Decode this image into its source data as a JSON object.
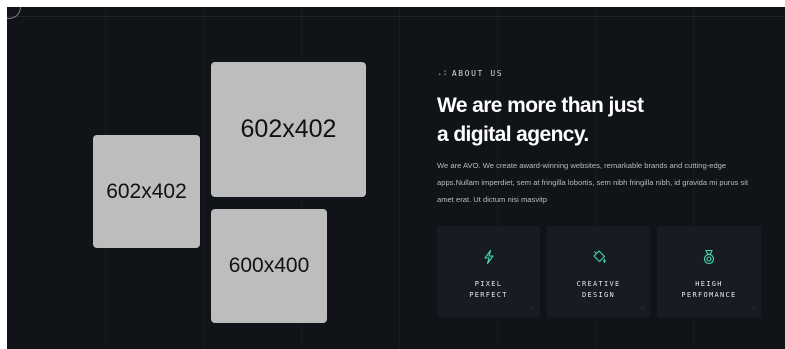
{
  "placeholders": {
    "small_left": "602x402",
    "large_top": "602x402",
    "bottom": "600x400"
  },
  "about": {
    "eyebrow_dots": ".:",
    "eyebrow": "ABOUT US",
    "headline_line1": "We are more than just",
    "headline_line2": "a digital agency.",
    "description": "We are AVO. We create award-winning websites, remarkable brands and cutting-edge apps.Nullam imperdiet, sem at fringilla lobortis, sem nibh fringilla nibh, id gravida mi purus sit amet erat. Ut dictum nisi masvitp"
  },
  "features": [
    {
      "label": "PIXEL\nPERFECT",
      "icon": "lightning-icon"
    },
    {
      "label": "CREATIVE\nDESIGN",
      "icon": "paint-bucket-icon"
    },
    {
      "label": "HEIGH\nPERFOMANCE",
      "icon": "medal-icon"
    }
  ],
  "colors": {
    "background": "#101418",
    "accent": "#49d7ad",
    "card": "#171c22"
  }
}
